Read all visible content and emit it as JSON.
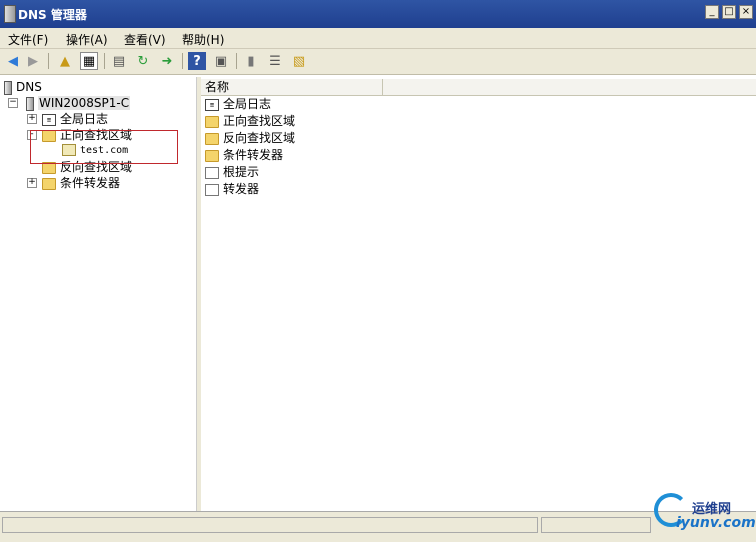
{
  "window": {
    "title": "DNS 管理器",
    "minimize": "_",
    "maximize": "□",
    "close": "×"
  },
  "menu": {
    "items": [
      "文件(F)",
      "操作(A)",
      "查看(V)",
      "帮助(H)"
    ]
  },
  "tree": {
    "root_label": "DNS",
    "server_label": "WIN2008SP1-C",
    "nodes": [
      {
        "label": "全局日志",
        "expander": "+"
      },
      {
        "label": "正向查找区域",
        "expander": "-"
      },
      {
        "label": "test.com"
      },
      {
        "label": "反向查找区域"
      },
      {
        "label": "条件转发器",
        "expander": "+"
      }
    ]
  },
  "list": {
    "column_header": "名称",
    "items": [
      "全局日志",
      "正向查找区域",
      "反向查找区域",
      "条件转发器",
      "根提示",
      "转发器"
    ]
  },
  "watermark": {
    "brand": "运维网",
    "domain": "iyunv.com"
  },
  "colors": {
    "title_bar": "#2f55a4",
    "chrome": "#ece9d8",
    "highlight_box": "#c0282d",
    "folder": "#f4d46b"
  }
}
